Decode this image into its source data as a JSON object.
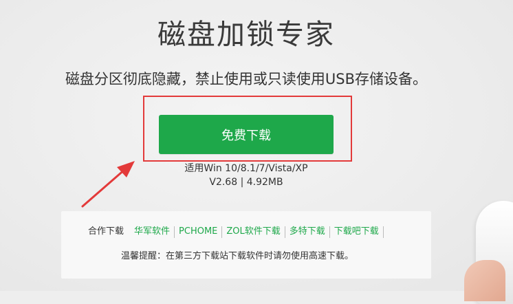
{
  "header": {
    "title": "磁盘加锁专家",
    "subtitle": "磁盘分区彻底隐藏，禁止使用或只读使用USB存储设备。"
  },
  "download": {
    "button_label": "免费下载",
    "system_requirements": "适用Win 10/8.1/7/Vista/XP",
    "version_size": "V2.68 | 4.92MB"
  },
  "partners": {
    "label": "合作下载",
    "links": [
      "华军软件",
      "PCHOME",
      "ZOL软件下载",
      "多特下载",
      "下载吧下载"
    ]
  },
  "notice": "温馨提醒：在第三方下载站下载软件时请勿使用高速下载。",
  "colors": {
    "accent_green": "#1ea84a",
    "annotation_red": "#e33a3a"
  }
}
